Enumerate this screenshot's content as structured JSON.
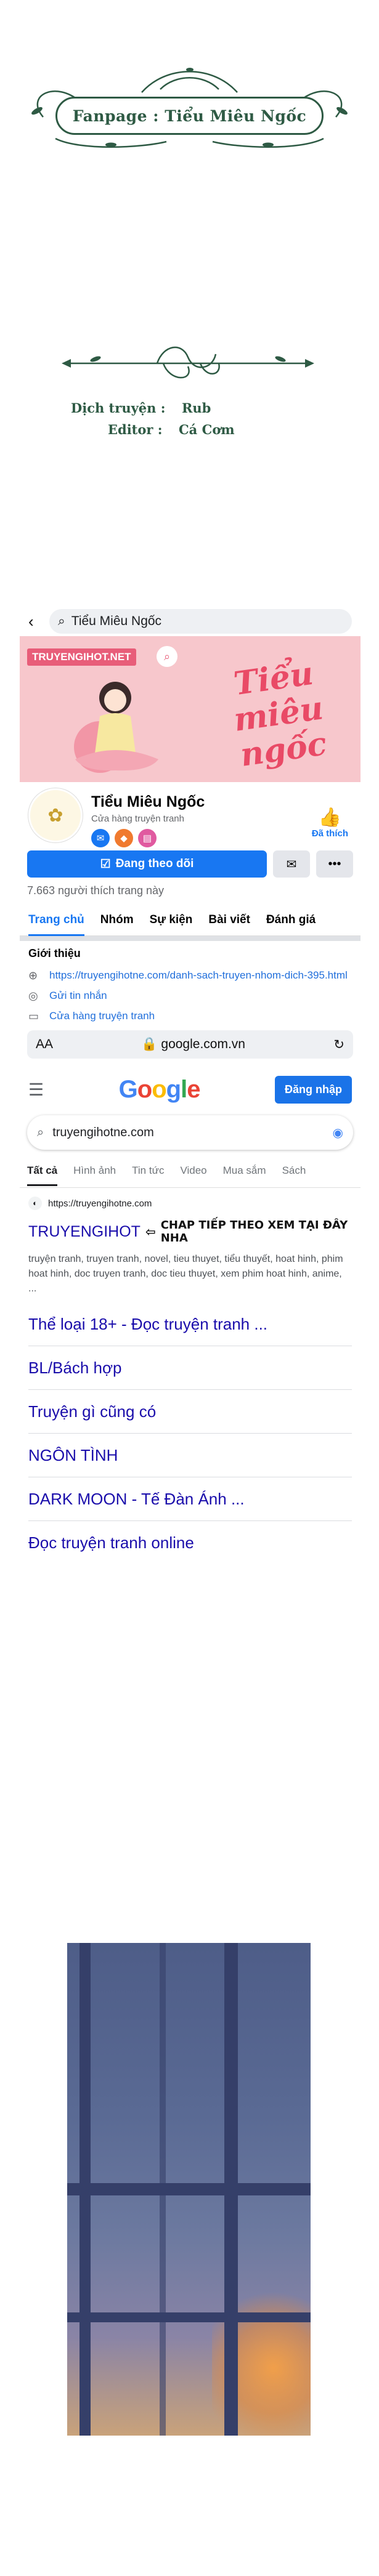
{
  "banner": {
    "text": "Fanpage : Tiểu Miêu Ngốc"
  },
  "credits": {
    "translator_label": "Dịch truyện :",
    "translator_name": "Rub",
    "editor_label": "Editor :",
    "editor_name": "Cá Cơm"
  },
  "facebook": {
    "search_text": "Tiểu Miêu Ngốc",
    "cover": {
      "brand": "TRUYENGIHOT.NET",
      "title": "Tiểu miêu ngốc"
    },
    "page_name": "Tiểu Miêu Ngốc",
    "category": "Cửa hàng truyện tranh",
    "like_label": "Đã thích",
    "follow_label": "Đang theo dõi",
    "likes_count": "7.663 người thích trang này",
    "tabs": [
      "Trang chủ",
      "Nhóm",
      "Sự kiện",
      "Bài viết",
      "Đánh giá"
    ],
    "intro": {
      "title": "Giới thiệu",
      "link": "https://truyengihotne.com/danh-sach-truyen-nhom-dich-395.html",
      "message": "Gửi tin nhắn",
      "shop": "Cửa hàng truyện tranh"
    }
  },
  "browser": {
    "text_size": "AA",
    "url": "google.com.vn"
  },
  "google": {
    "logo": "Google",
    "signin": "Đăng nhập",
    "query": "truyengihotne.com",
    "tabs": [
      "Tất cả",
      "Hình ảnh",
      "Tin tức",
      "Video",
      "Mua sắm",
      "Sách"
    ],
    "result": {
      "url": "https://truyengihotne.com",
      "title": "TRUYENGIHOT",
      "annotation": "CHAP TIẾP THEO XEM TẠI ĐÂY NHA",
      "snippet": "truyện tranh, truyen tranh, novel, tieu thuyet, tiểu thuyết, hoat hinh, phim hoat hinh, doc truyen tranh, doc tieu thuyet, xem phim hoat hinh, anime, ..."
    },
    "sitelinks": [
      "Thể loại 18+ - Đọc truyện tranh ...",
      "BL/Bách hợp",
      "Truyện gì cũng có",
      "NGÔN TÌNH",
      "DARK MOON - Tế Đàn Ánh ...",
      "Đọc truyện tranh online"
    ]
  },
  "colors": {
    "fb_blue": "#1877f2",
    "google_link": "#1a0dab",
    "banner_green": "#2e5a44"
  }
}
